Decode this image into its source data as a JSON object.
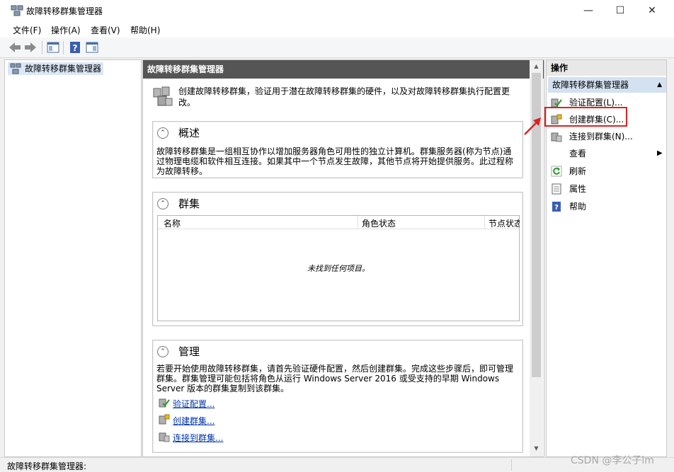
{
  "window": {
    "title": "故障转移群集管理器",
    "minimize": "—",
    "maximize": "☐",
    "close": "✕"
  },
  "menu": [
    "文件(F)",
    "操作(A)",
    "查看(V)",
    "帮助(H)"
  ],
  "tree": {
    "root_label": "故障转移群集管理器"
  },
  "center": {
    "header": "故障转移群集管理器",
    "description": "创建故障转移群集，验证用于潜在故障转移群集的硬件，以及对故障转移群集执行配置更改。",
    "overview": {
      "title": "概述",
      "text": "故障转移群集是一组相互协作以增加服务器角色可用性的独立计算机。群集服务器(称为节点)通过物理电缆和软件相互连接。如果其中一个节点发生故障，其他节点将开始提供服务。此过程称为故障转移。"
    },
    "clusters": {
      "title": "群集",
      "columns": [
        "名称",
        "角色状态",
        "节点状态"
      ],
      "empty_text": "未找到任何项目。"
    },
    "management": {
      "title": "管理",
      "text": "若要开始使用故障转移群集，请首先验证硬件配置，然后创建群集。完成这些步骤后，即可管理群集。群集管理可能包括将角色从运行 Windows Server 2016 或受支持的早期 Windows Server 版本的群集复制到该群集。",
      "links": [
        "验证配置...",
        "创建群集...",
        "连接到群集..."
      ]
    }
  },
  "actions": {
    "header": "操作",
    "group": "故障转移群集管理器",
    "items": [
      {
        "label": "验证配置(L)...",
        "icon": "validate-icon"
      },
      {
        "label": "创建群集(C)...",
        "icon": "create-cluster-icon"
      },
      {
        "label": "连接到群集(N)...",
        "icon": "connect-icon"
      },
      {
        "label": "查看",
        "icon": ""
      },
      {
        "label": "刷新",
        "icon": "refresh-icon"
      },
      {
        "label": "属性",
        "icon": "properties-icon"
      },
      {
        "label": "帮助",
        "icon": "help-icon"
      }
    ]
  },
  "status": {
    "text": "故障转移群集管理器:"
  },
  "watermark": "CSDN @李公子lm",
  "colors": {
    "accent": "#dbe7f7",
    "highlight": "#e02020",
    "header": "#555555"
  }
}
